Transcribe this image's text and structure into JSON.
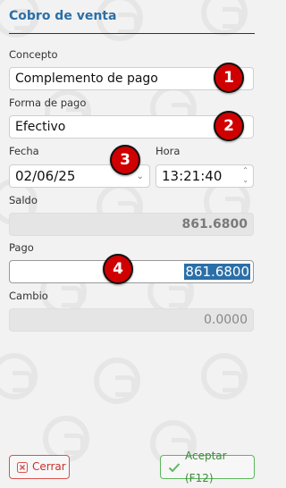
{
  "title": "Cobro de venta",
  "concepto": {
    "label": "Concepto",
    "value": "Complemento de pago"
  },
  "forma_pago": {
    "label": "Forma de pago",
    "value": "Efectivo"
  },
  "fecha": {
    "label": "Fecha",
    "value": "02/06/25"
  },
  "hora": {
    "label": "Hora",
    "value": "13:21:40"
  },
  "saldo": {
    "label": "Saldo",
    "value": "861.6800"
  },
  "pago": {
    "label": "Pago",
    "value": "861.6800"
  },
  "cambio": {
    "label": "Cambio",
    "value": "0.0000"
  },
  "badges": [
    "1",
    "2",
    "3",
    "4"
  ],
  "buttons": {
    "cancel": "Cerrar",
    "ok": "Aceptar (F12)"
  },
  "colors": {
    "title": "#2a6fa8",
    "badge": "#d00000",
    "cancel": "#d9534f",
    "ok": "#5cb85c",
    "selection": "#2a6fa8"
  }
}
